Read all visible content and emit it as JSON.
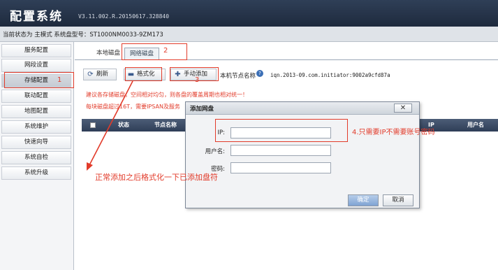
{
  "app": {
    "title": "配置系统",
    "version": "V3.11.002.R.20150617.328840"
  },
  "status": {
    "text": "当前状态为 主模式 系统盘型号：ST1000NM0033-9ZM173"
  },
  "sidebar": {
    "items": [
      {
        "label": "服务配置"
      },
      {
        "label": "网段设置"
      },
      {
        "label": "存储配置"
      },
      {
        "label": "联动配置"
      },
      {
        "label": "地图配置"
      },
      {
        "label": "系统维护"
      },
      {
        "label": "快速向导"
      },
      {
        "label": "系统自检"
      },
      {
        "label": "系统升级"
      }
    ]
  },
  "tabs": [
    {
      "label": "本地磁盘"
    },
    {
      "label": "网络磁盘"
    }
  ],
  "toolbar": {
    "refresh_label": "刷新",
    "format_label": "格式化",
    "manual_add_label": "手动添加",
    "initiator_label": "本机节点名称",
    "initiator_value": "iqn.2013-09.com.initiator:9002a9cfd87a"
  },
  "tips": {
    "line1": "建议各存储磁盘，空间相对均匀，则各盘的覆盖周期也相对统一！",
    "line2": "每块磁盘超过16T，需要IPSAN及服务"
  },
  "table": {
    "headers": [
      "状态",
      "节点名称",
      "IP",
      "用户名"
    ]
  },
  "dialog": {
    "title": "添加网盘",
    "close_symbol": "✕",
    "ip_label": "IP:",
    "username_label": "用户名:",
    "password_label": "密码:",
    "ip_value": "",
    "username_value": "",
    "password_value": "",
    "ok_label": "确定",
    "cancel_label": "取消"
  },
  "annotations": {
    "n1": "1",
    "n2": "2",
    "n3": "3",
    "ip_note": "4.只需要IP不需要账号密码",
    "format_note": "正常添加之后格式化一下已添加盘符",
    "color": "#e23b2a"
  },
  "icons": {
    "refresh": "refresh-icon",
    "format": "format-icon",
    "add": "plus-icon",
    "help": "question-icon"
  }
}
